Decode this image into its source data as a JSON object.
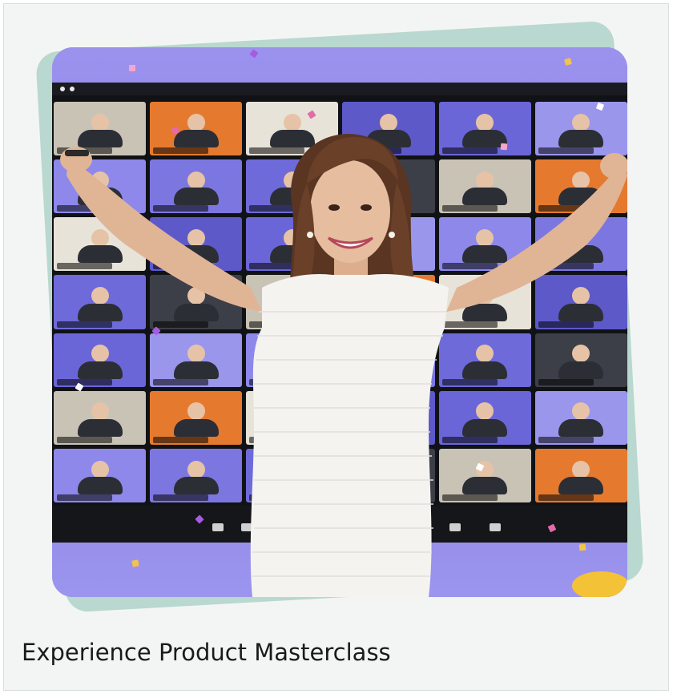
{
  "card": {
    "caption": "Experience Product Masterclass"
  },
  "image": {
    "icon": "masterclass-hero-photo"
  },
  "colors": {
    "card_bg": "#f3f5f4",
    "teal_frame": "#b9d8cf",
    "photo_bg": "#8e86e6",
    "caption_text": "#1a1a1a"
  }
}
